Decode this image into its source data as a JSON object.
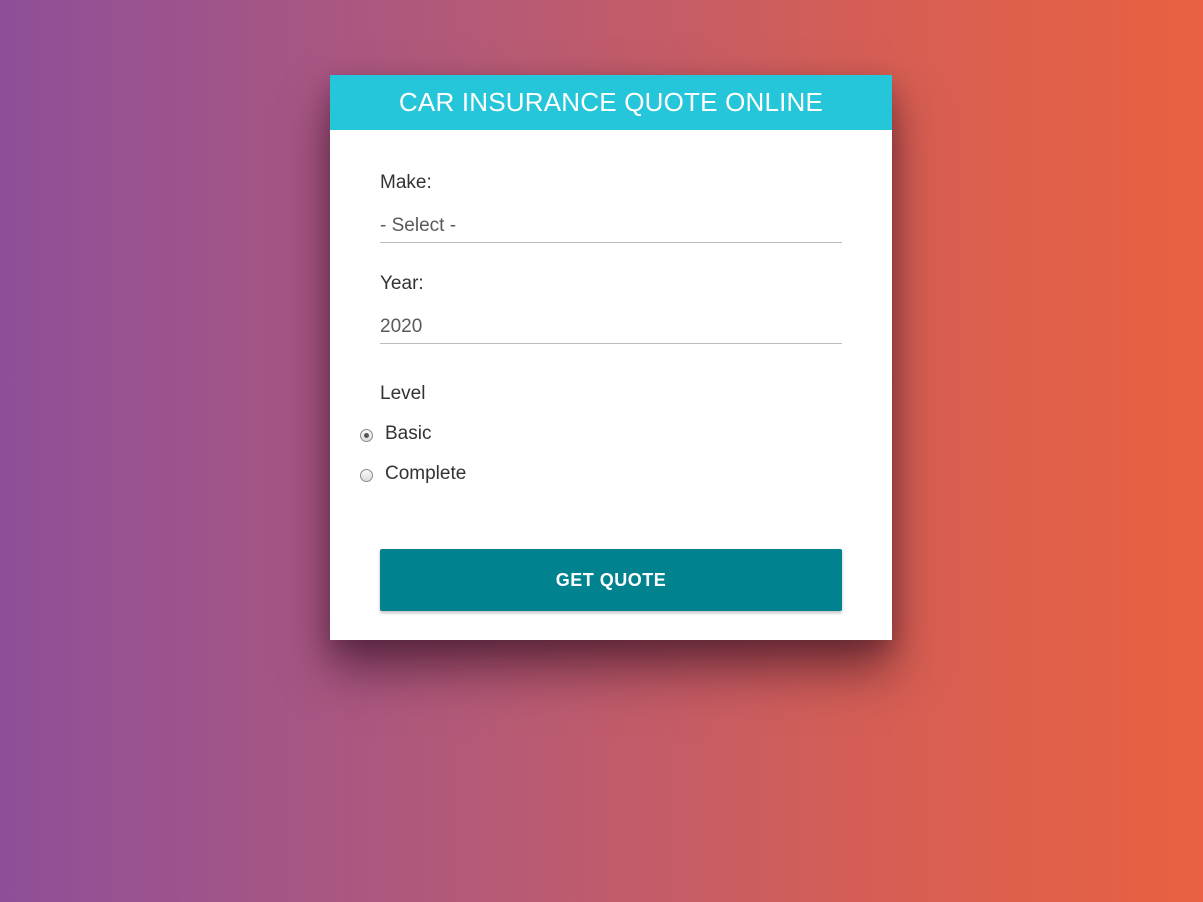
{
  "header": {
    "title": "CAR INSURANCE QUOTE ONLINE"
  },
  "form": {
    "make": {
      "label": "Make:",
      "value": "- Select -"
    },
    "year": {
      "label": "Year:",
      "value": "2020"
    },
    "level": {
      "label": "Level",
      "options": [
        {
          "label": "Basic",
          "checked": true
        },
        {
          "label": "Complete",
          "checked": false
        }
      ]
    },
    "submit_label": "GET QUOTE"
  },
  "colors": {
    "header_bg": "#26c6da",
    "button_bg": "#00838f",
    "gradient_start": "#8e4f99",
    "gradient_end": "#e96140"
  }
}
